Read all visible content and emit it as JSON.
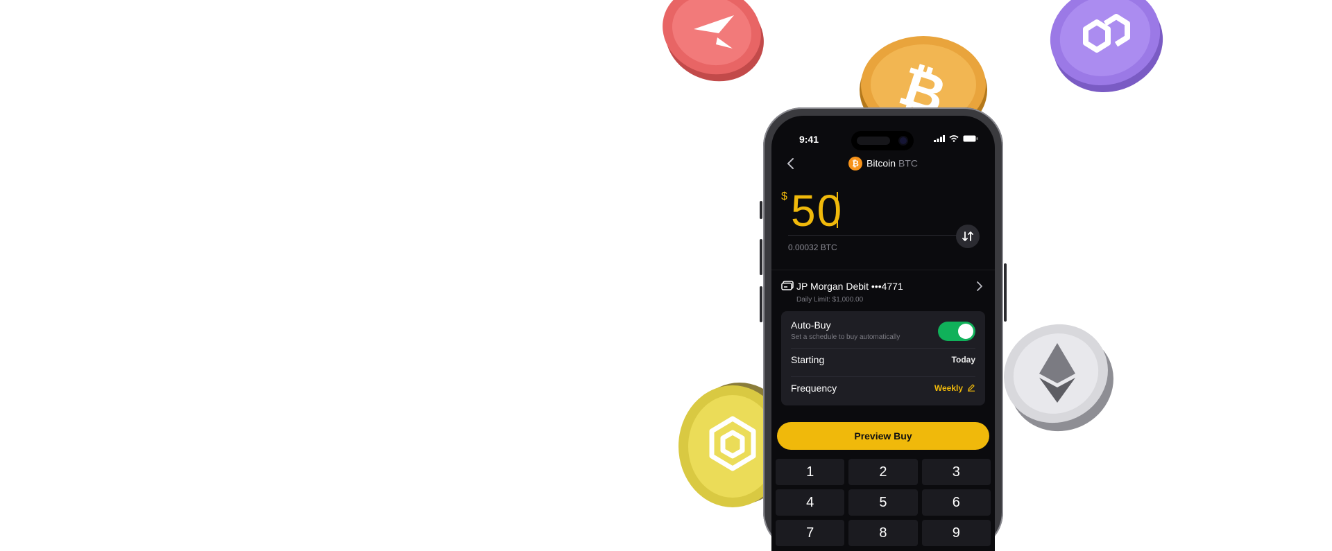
{
  "colors": {
    "accent": "#F0B90B",
    "toggle_on": "#10B15A",
    "bitcoin": "#F7931A",
    "screen_bg": "#0B0B0E",
    "panel_bg": "#1E1E24"
  },
  "decor_coins": [
    "arc-coin-icon",
    "bitcoin-coin-icon",
    "polygon-coin-icon",
    "bnb-coin-icon",
    "ethereum-coin-icon"
  ],
  "status_bar": {
    "time": "9:41",
    "icons": [
      "signal-icon",
      "wifi-icon",
      "battery-icon"
    ]
  },
  "header": {
    "asset_name": "Bitcoin",
    "asset_symbol": "BTC",
    "asset_glyph": "₿"
  },
  "amount": {
    "currency_symbol": "$",
    "value": "50",
    "converted": "0.00032 BTC"
  },
  "payment": {
    "method": "JP Morgan Debit •••4771",
    "limit": "Daily Limit: $1,000.00"
  },
  "auto_buy": {
    "label": "Auto-Buy",
    "description": "Set a schedule to buy automatically",
    "enabled": true,
    "starting_label": "Starting",
    "starting_value": "Today",
    "frequency_label": "Frequency",
    "frequency_value": "Weekly"
  },
  "cta_label": "Preview Buy",
  "keypad": [
    "1",
    "2",
    "3",
    "4",
    "5",
    "6",
    "7",
    "8",
    "9"
  ]
}
